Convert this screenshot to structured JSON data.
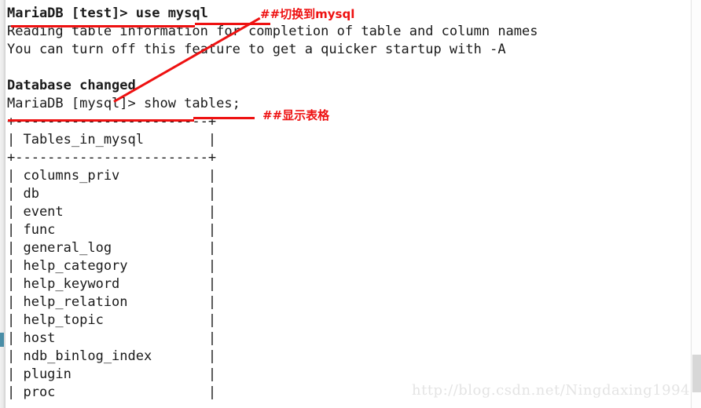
{
  "terminal": {
    "lines": [
      {
        "text": "MariaDB [test]> use mysql",
        "bold": true
      },
      {
        "text": "Reading table information for completion of table and column names",
        "bold": false
      },
      {
        "text": "You can turn off this feature to get a quicker startup with -A",
        "bold": false
      },
      {
        "text": "",
        "bold": false
      },
      {
        "text": "Database changed",
        "bold": true
      },
      {
        "text": "MariaDB [mysql]> show tables;",
        "bold": false
      },
      {
        "text": "+------------------------+",
        "bold": false
      },
      {
        "text": "| Tables_in_mysql        |",
        "bold": false
      },
      {
        "text": "+------------------------+",
        "bold": false
      },
      {
        "text": "| columns_priv           |",
        "bold": false
      },
      {
        "text": "| db                     |",
        "bold": false
      },
      {
        "text": "| event                  |",
        "bold": false
      },
      {
        "text": "| func                   |",
        "bold": false
      },
      {
        "text": "| general_log            |",
        "bold": false
      },
      {
        "text": "| help_category          |",
        "bold": false
      },
      {
        "text": "| help_keyword           |",
        "bold": false
      },
      {
        "text": "| help_relation          |",
        "bold": false
      },
      {
        "text": "| help_topic             |",
        "bold": false
      },
      {
        "text": "| host                   |",
        "bold": false
      },
      {
        "text": "| ndb_binlog_index       |",
        "bold": false
      },
      {
        "text": "| plugin                 |",
        "bold": false
      },
      {
        "text": "| proc                   |",
        "bold": false
      }
    ],
    "prompt_use": "MariaDB [test]> use mysql",
    "prompt_show": "MariaDB [mysql]> show tables;",
    "status_database_changed": "Database changed",
    "info_line_1": "Reading table information for completion of table and column names",
    "info_line_2": "You can turn off this feature to get a quicker startup with -A",
    "result_table": {
      "column_header": "Tables_in_mysql",
      "rows": [
        "columns_priv",
        "db",
        "event",
        "func",
        "general_log",
        "help_category",
        "help_keyword",
        "help_relation",
        "help_topic",
        "host",
        "ndb_binlog_index",
        "plugin",
        "proc"
      ]
    }
  },
  "annotations": {
    "use_mysql": "##切换到mysql",
    "show_tables": "##显示表格",
    "color": "#ee1111"
  },
  "watermark": {
    "text": "http://blog.csdn.net/Ningdaxing1994",
    "color": "#e4e4e4"
  }
}
